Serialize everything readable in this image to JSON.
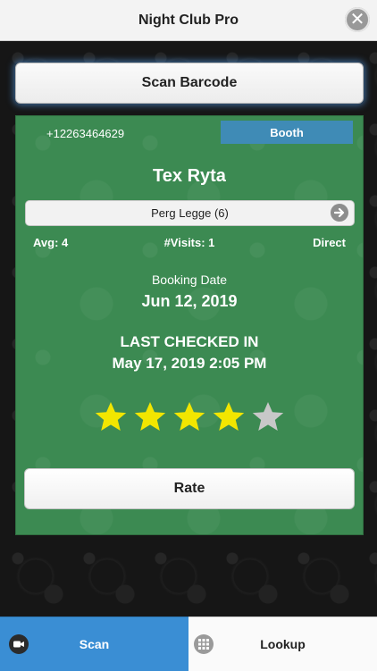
{
  "header": {
    "title": "Night Club Pro",
    "close_glyph": "✕",
    "close_icon": "close-icon"
  },
  "scan_bar": {
    "label": "Scan Barcode"
  },
  "card": {
    "phone": "+12263464629",
    "tag": "Booth",
    "guest_name": "Tex Ryta",
    "promoter": "Perg Legge (6)",
    "promoter_arrow_icon": "arrow-right-icon",
    "stats": {
      "avg": "Avg: 4",
      "visits": "#Visits: 1",
      "source": "Direct"
    },
    "booking_label": "Booking Date",
    "booking_date": "Jun 12, 2019",
    "last_checked_label": "LAST CHECKED IN",
    "last_checked_date": "May 17, 2019 2:05 PM",
    "rating": {
      "value": 4,
      "max": 5
    },
    "rate_label": "Rate"
  },
  "footer": {
    "tabs": [
      {
        "label": "Scan",
        "icon": "camera-icon",
        "active": true
      },
      {
        "label": "Lookup",
        "icon": "grid-icon",
        "active": false
      }
    ]
  },
  "colors": {
    "card_green": "#3c8a52",
    "tag_blue": "#3f8bb6",
    "active_tab_blue": "#3a8ed4",
    "star_filled": "#f2e600",
    "star_empty": "#c8c8c8"
  }
}
